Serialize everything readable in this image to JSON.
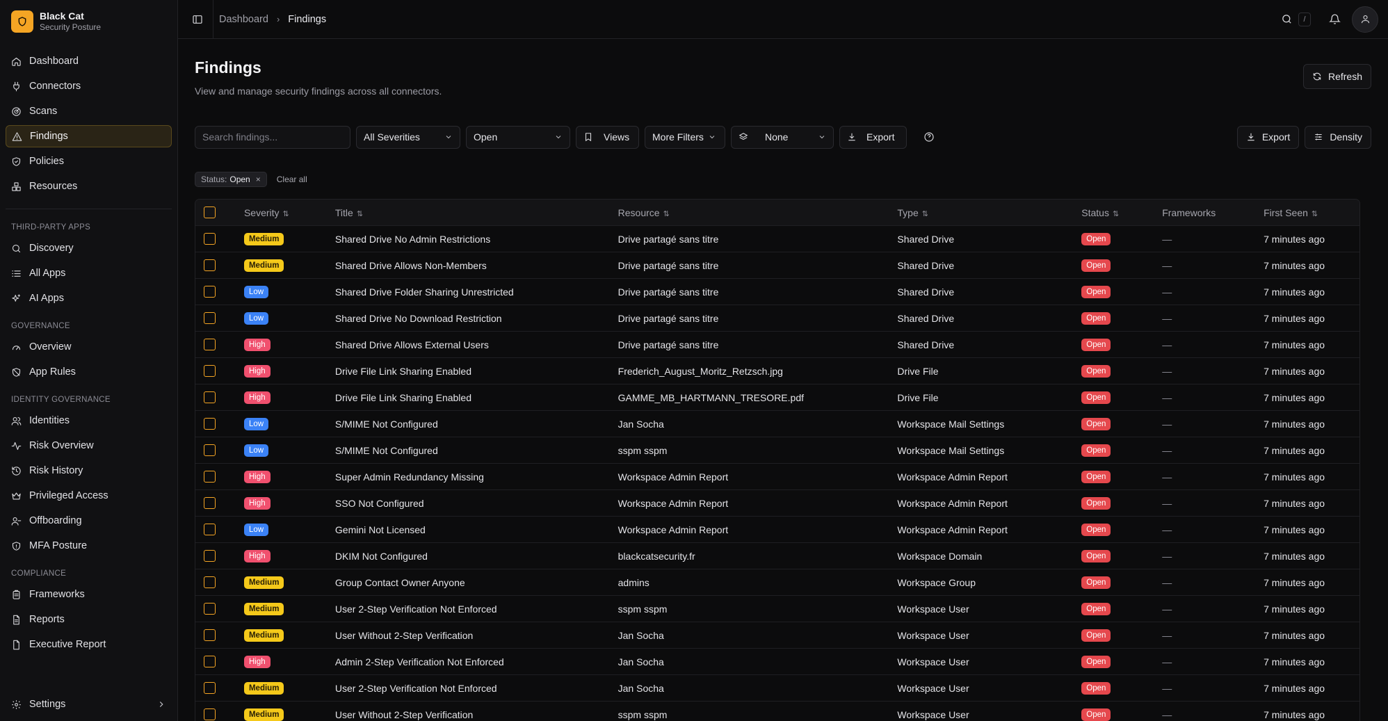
{
  "brand": {
    "title": "Black Cat",
    "subtitle": "Security Posture",
    "accent": "#f5a524"
  },
  "nav": {
    "main": [
      {
        "label": "Dashboard",
        "icon": "home-icon"
      },
      {
        "label": "Connectors",
        "icon": "plug-icon"
      },
      {
        "label": "Scans",
        "icon": "radar-icon"
      },
      {
        "label": "Findings",
        "icon": "warning-triangle-icon",
        "active": true
      },
      {
        "label": "Policies",
        "icon": "shield-check-icon"
      },
      {
        "label": "Resources",
        "icon": "boxes-icon"
      }
    ],
    "third_party_title": "THIRD-PARTY APPS",
    "third_party": [
      {
        "label": "Discovery",
        "icon": "search-icon"
      },
      {
        "label": "All Apps",
        "icon": "list-icon"
      },
      {
        "label": "AI Apps",
        "icon": "sparkles-icon"
      }
    ],
    "governance_title": "GOVERNANCE",
    "governance": [
      {
        "label": "Overview",
        "icon": "gauge-icon"
      },
      {
        "label": "App Rules",
        "icon": "shield-off-icon"
      }
    ],
    "identity_title": "IDENTITY GOVERNANCE",
    "identity": [
      {
        "label": "Identities",
        "icon": "users-icon"
      },
      {
        "label": "Risk Overview",
        "icon": "activity-icon"
      },
      {
        "label": "Risk History",
        "icon": "history-icon"
      },
      {
        "label": "Privileged Access",
        "icon": "crown-icon"
      },
      {
        "label": "Offboarding",
        "icon": "user-minus-icon"
      },
      {
        "label": "MFA Posture",
        "icon": "shield-icon"
      }
    ],
    "compliance_title": "COMPLIANCE",
    "compliance": [
      {
        "label": "Frameworks",
        "icon": "clipboard-icon"
      },
      {
        "label": "Reports",
        "icon": "file-text-icon"
      },
      {
        "label": "Executive Report",
        "icon": "file-icon"
      }
    ],
    "settings": "Settings"
  },
  "topbar": {
    "breadcrumb_root": "Dashboard",
    "breadcrumb_current": "Findings",
    "search_shortcut": "/"
  },
  "page": {
    "title": "Findings",
    "description": "View and manage security findings across all connectors.",
    "refresh_label": "Refresh"
  },
  "filters": {
    "search_placeholder": "Search findings...",
    "severity": "All Severities",
    "status": "Open",
    "views": "Views",
    "more_filters": "More Filters",
    "group_by": "None",
    "export_left": "Export",
    "export_right": "Export",
    "density": "Density"
  },
  "active_filters": {
    "chip_key": "Status:",
    "chip_value": "Open",
    "clear_all": "Clear all"
  },
  "table": {
    "columns": [
      "Severity",
      "Title",
      "Resource",
      "Type",
      "Status",
      "Frameworks",
      "First Seen"
    ],
    "rows": [
      {
        "severity": "Medium",
        "title": "Shared Drive No Admin Restrictions",
        "resource": "Drive partagé sans titre",
        "type": "Shared Drive",
        "status": "Open",
        "frameworks": "—",
        "first_seen": "7 minutes ago"
      },
      {
        "severity": "Medium",
        "title": "Shared Drive Allows Non-Members",
        "resource": "Drive partagé sans titre",
        "type": "Shared Drive",
        "status": "Open",
        "frameworks": "—",
        "first_seen": "7 minutes ago"
      },
      {
        "severity": "Low",
        "title": "Shared Drive Folder Sharing Unrestricted",
        "resource": "Drive partagé sans titre",
        "type": "Shared Drive",
        "status": "Open",
        "frameworks": "—",
        "first_seen": "7 minutes ago"
      },
      {
        "severity": "Low",
        "title": "Shared Drive No Download Restriction",
        "resource": "Drive partagé sans titre",
        "type": "Shared Drive",
        "status": "Open",
        "frameworks": "—",
        "first_seen": "7 minutes ago"
      },
      {
        "severity": "High",
        "title": "Shared Drive Allows External Users",
        "resource": "Drive partagé sans titre",
        "type": "Shared Drive",
        "status": "Open",
        "frameworks": "—",
        "first_seen": "7 minutes ago"
      },
      {
        "severity": "High",
        "title": "Drive File Link Sharing Enabled",
        "resource": "Frederich_August_Moritz_Retzsch.jpg",
        "type": "Drive File",
        "status": "Open",
        "frameworks": "—",
        "first_seen": "7 minutes ago"
      },
      {
        "severity": "High",
        "title": "Drive File Link Sharing Enabled",
        "resource": "GAMME_MB_HARTMANN_TRESORE.pdf",
        "type": "Drive File",
        "status": "Open",
        "frameworks": "—",
        "first_seen": "7 minutes ago"
      },
      {
        "severity": "Low",
        "title": "S/MIME Not Configured",
        "resource": "Jan Socha",
        "type": "Workspace Mail Settings",
        "status": "Open",
        "frameworks": "—",
        "first_seen": "7 minutes ago"
      },
      {
        "severity": "Low",
        "title": "S/MIME Not Configured",
        "resource": "sspm sspm",
        "type": "Workspace Mail Settings",
        "status": "Open",
        "frameworks": "—",
        "first_seen": "7 minutes ago"
      },
      {
        "severity": "High",
        "title": "Super Admin Redundancy Missing",
        "resource": "Workspace Admin Report",
        "type": "Workspace Admin Report",
        "status": "Open",
        "frameworks": "—",
        "first_seen": "7 minutes ago"
      },
      {
        "severity": "High",
        "title": "SSO Not Configured",
        "resource": "Workspace Admin Report",
        "type": "Workspace Admin Report",
        "status": "Open",
        "frameworks": "—",
        "first_seen": "7 minutes ago"
      },
      {
        "severity": "Low",
        "title": "Gemini Not Licensed",
        "resource": "Workspace Admin Report",
        "type": "Workspace Admin Report",
        "status": "Open",
        "frameworks": "—",
        "first_seen": "7 minutes ago"
      },
      {
        "severity": "High",
        "title": "DKIM Not Configured",
        "resource": "blackcatsecurity.fr",
        "type": "Workspace Domain",
        "status": "Open",
        "frameworks": "—",
        "first_seen": "7 minutes ago"
      },
      {
        "severity": "Medium",
        "title": "Group Contact Owner Anyone",
        "resource": "admins",
        "type": "Workspace Group",
        "status": "Open",
        "frameworks": "—",
        "first_seen": "7 minutes ago"
      },
      {
        "severity": "Medium",
        "title": "User 2-Step Verification Not Enforced",
        "resource": "sspm sspm",
        "type": "Workspace User",
        "status": "Open",
        "frameworks": "—",
        "first_seen": "7 minutes ago"
      },
      {
        "severity": "Medium",
        "title": "User Without 2-Step Verification",
        "resource": "Jan Socha",
        "type": "Workspace User",
        "status": "Open",
        "frameworks": "—",
        "first_seen": "7 minutes ago"
      },
      {
        "severity": "High",
        "title": "Admin 2-Step Verification Not Enforced",
        "resource": "Jan Socha",
        "type": "Workspace User",
        "status": "Open",
        "frameworks": "—",
        "first_seen": "7 minutes ago"
      },
      {
        "severity": "Medium",
        "title": "User 2-Step Verification Not Enforced",
        "resource": "Jan Socha",
        "type": "Workspace User",
        "status": "Open",
        "frameworks": "—",
        "first_seen": "7 minutes ago"
      },
      {
        "severity": "Medium",
        "title": "User Without 2-Step Verification",
        "resource": "sspm sspm",
        "type": "Workspace User",
        "status": "Open",
        "frameworks": "—",
        "first_seen": "7 minutes ago"
      }
    ]
  },
  "colors": {
    "severity_medium": "#f5c91a",
    "severity_low": "#3b82f6",
    "severity_high": "#f0506e",
    "status_open": "#e5484d"
  }
}
